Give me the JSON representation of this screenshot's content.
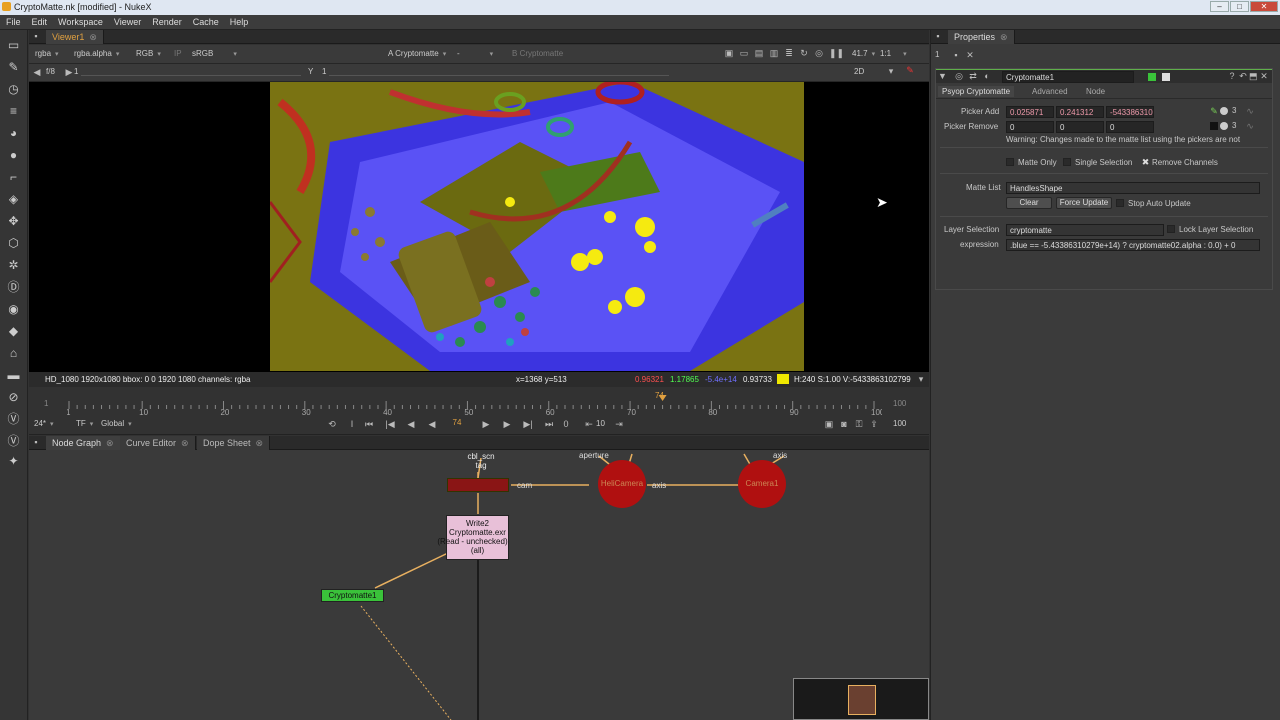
{
  "window": {
    "title": "CryptoMatte.nk [modified] - NukeX",
    "controls": [
      "–",
      "□",
      "✕"
    ]
  },
  "menu": [
    "File",
    "Edit",
    "Workspace",
    "Viewer",
    "Render",
    "Cache",
    "Help"
  ],
  "viewer": {
    "tab": "Viewer1",
    "channel_set": "rgba",
    "channel": "rgba.alpha",
    "display": "RGB",
    "ip": "IP",
    "lut": "sRGB",
    "a_label": "A",
    "a_input": "Cryptomatte",
    "a_op": "-",
    "b_label": "B",
    "b_input": "Cryptomatte",
    "fstop": "f/8",
    "frame_one": "1",
    "y_label": "Y",
    "y_value": "1",
    "zoom": "41.7",
    "ratio": "1:1",
    "mode": "2D",
    "status_left": "HD_1080 1920x1080  bbox: 0 0 1920 1080 channels: rgba",
    "status_xy": "x=1368 y=513",
    "status_r": "0.96321",
    "status_g": "1.17865",
    "status_b": "-5.4e+14",
    "status_a": "0.93733",
    "status_hsv": "H:240 S:1.00 V:-5433863102799",
    "swatch_color": "#f0e800"
  },
  "timeline": {
    "start": "1",
    "end": "100",
    "current": "74",
    "marker": "74",
    "ticks": [
      "1",
      "10",
      "20",
      "30",
      "40",
      "50",
      "60",
      "70",
      "80",
      "90",
      "100"
    ],
    "fps": "24*",
    "tf": "TF",
    "scope": "Global",
    "frame_field": "74",
    "step": "10",
    "end_field": "100",
    "zero": "0"
  },
  "panels": {
    "node_graph": "Node Graph",
    "curve_editor": "Curve Editor",
    "dope_sheet": "Dope Sheet"
  },
  "nodes": {
    "top_label": "cbl_scn\ntag",
    "cam_label": "cam",
    "aperture": "aperture",
    "axis_label1": "axis",
    "axis_label2": "axis",
    "cam_node": "HeliCamera",
    "camera2": "Camera1",
    "write_title": "Write2",
    "write_sub1": "Cryptomatte.exr",
    "write_sub2": "(Read - unchecked)",
    "write_sub3": "(all)",
    "crypto": "Cryptomatte1"
  },
  "properties": {
    "tab": "Properties",
    "counter": "1",
    "node_name": "Cryptomatte1",
    "tabs": [
      "Psyop Cryptomatte",
      "Advanced",
      "Node"
    ],
    "picker_add_label": "Picker Add",
    "picker_add": [
      "0.025871",
      "0.241312",
      "-543386310"
    ],
    "picker_remove_label": "Picker Remove",
    "picker_remove": [
      "0",
      "0",
      "0"
    ],
    "picker_count": "3",
    "warning": "Warning: Changes made to the matte list using the pickers are not",
    "matte_only": "Matte Only",
    "single_selection": "Single Selection",
    "remove_channels": "Remove Channels",
    "matte_list_label": "Matte List",
    "matte_list": "HandlesShape",
    "clear": "Clear",
    "force_update": "Force Update",
    "stop_auto_update": "Stop Auto Update",
    "layer_selection_label": "Layer Selection",
    "layer_selection": "cryptomatte",
    "lock_layer": "Lock Layer Selection",
    "expression_label": "expression",
    "expression": ".blue == -5.43386310279e+14) ? cryptomatte02.alpha : 0.0) + 0"
  }
}
